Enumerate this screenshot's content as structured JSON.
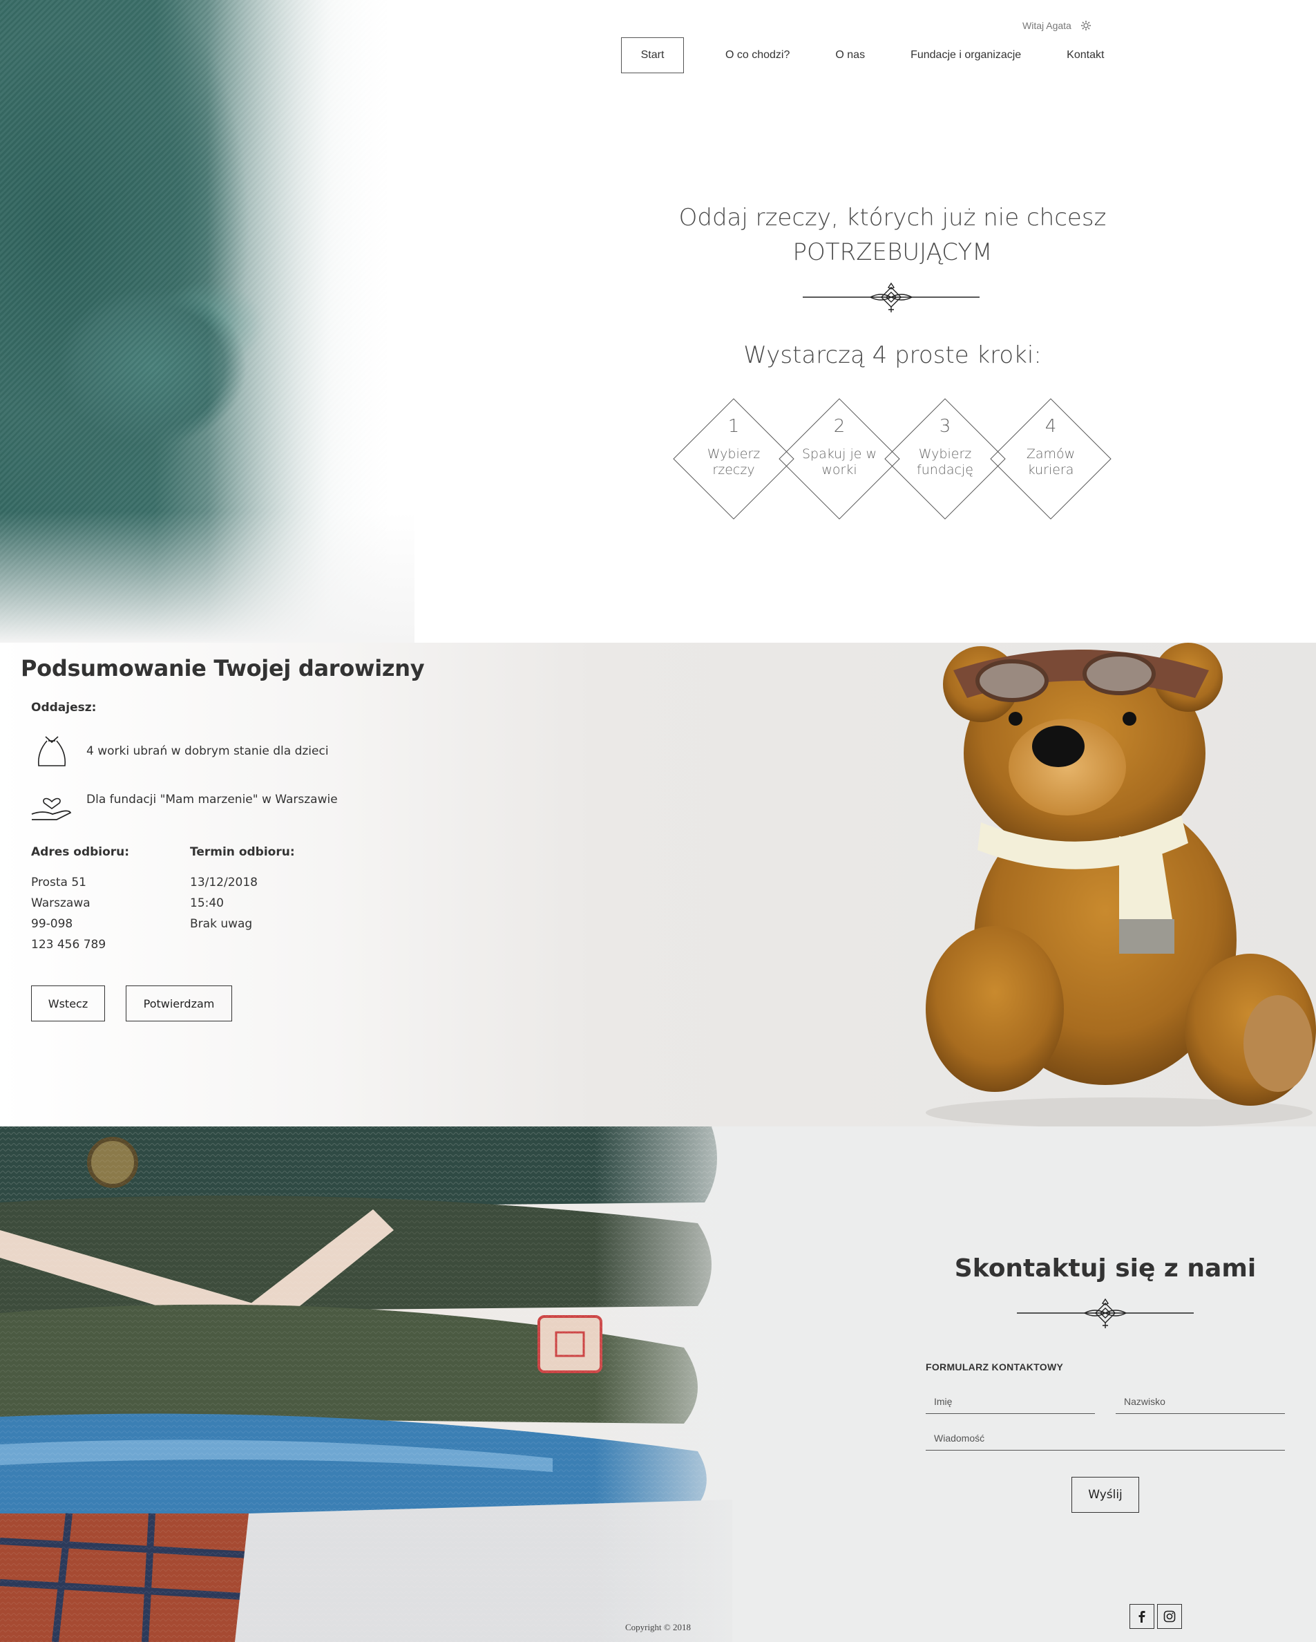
{
  "header": {
    "greeting": "Witaj Agata",
    "nav": [
      "Start",
      "O co chodzi?",
      "O nas",
      "Fundacje i organizacje",
      "Kontakt"
    ]
  },
  "hero": {
    "title_line1": "Oddaj rzeczy, których już nie chcesz",
    "title_line2": "POTRZEBUJĄCYM",
    "steps_title": "Wystarczą 4 proste kroki:",
    "steps": [
      {
        "num": "1",
        "line1": "Wybierz",
        "line2": "rzeczy"
      },
      {
        "num": "2",
        "line1": "Spakuj je w",
        "line2": "worki"
      },
      {
        "num": "3",
        "line1": "Wybierz",
        "line2": "fundację"
      },
      {
        "num": "4",
        "line1": "Zamów",
        "line2": "kuriera"
      }
    ]
  },
  "summary": {
    "title": "Podsumowanie Twojej darowizny",
    "giving_label": "Oddajesz:",
    "items_text": "4 worki ubrań w dobrym stanie dla dzieci",
    "foundation_text": "Dla fundacji \"Mam marzenie\" w Warszawie",
    "address_label": "Adres odbioru:",
    "address": [
      "Prosta 51",
      "Warszawa",
      "99-098",
      "123 456 789"
    ],
    "pickup_label": "Termin odbioru:",
    "pickup": [
      "13/12/2018",
      "15:40",
      "Brak uwag"
    ],
    "back_label": "Wstecz",
    "confirm_label": "Potwierdzam"
  },
  "contact": {
    "title": "Skontaktuj się z nami",
    "form_label": "FORMULARZ KONTAKTOWY",
    "first_name_placeholder": "Imię",
    "last_name_placeholder": "Nazwisko",
    "message_placeholder": "Wiadomość",
    "send_label": "Wyślij"
  },
  "footer": {
    "copyright": "Copyright © 2018",
    "social": [
      "facebook-icon",
      "instagram-icon"
    ]
  }
}
